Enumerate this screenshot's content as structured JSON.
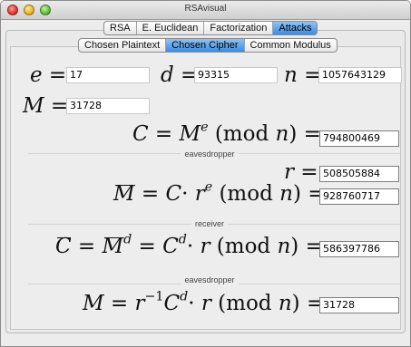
{
  "window": {
    "title": "RSAvisual"
  },
  "tabs": [
    "RSA",
    "E. Euclidean",
    "Factorization",
    "Attacks"
  ],
  "active_tab": "Attacks",
  "subtabs": [
    "Chosen Plaintext",
    "Chosen Cipher",
    "Common Modulus"
  ],
  "active_subtab": "Chosen Cipher",
  "params": {
    "e_label": "e =",
    "e_value": "17",
    "d_label": "d =",
    "d_value": "93315",
    "n_label": "n =",
    "n_value": "1057643129",
    "m_label": "M =",
    "m_value": "31728"
  },
  "cipher": {
    "formula_left": "C = M",
    "exp": "e",
    "formula_right": "(mod n) =",
    "value": "794800469"
  },
  "section_labels": [
    "eavesdropper",
    "receiver",
    "eavesdropper"
  ],
  "r": {
    "label": "r =",
    "value": "508505884"
  },
  "m_bar": {
    "value": "928760717"
  },
  "c_bar": {
    "value": "586397786"
  },
  "m_result": {
    "value": "31728"
  }
}
